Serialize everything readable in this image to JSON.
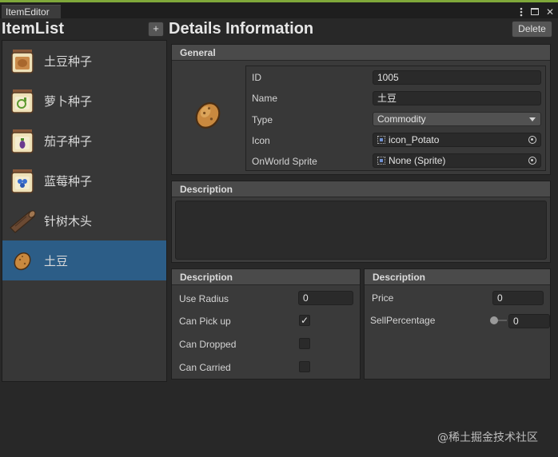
{
  "window": {
    "tab_title": "ItemEditor",
    "menu_icon": "kebab-menu-icon",
    "maximize_icon": "maximize-icon",
    "close_icon": "close-icon",
    "close_glyph": "✕",
    "accent_color": "#7fa83a"
  },
  "item_list": {
    "title": "ItemList",
    "add_label": "+",
    "items": [
      {
        "label": "土豆种子",
        "icon": "potato-seed-jar-icon",
        "selected": false
      },
      {
        "label": "萝卜种子",
        "icon": "radish-seed-jar-icon",
        "selected": false
      },
      {
        "label": "茄子种子",
        "icon": "eggplant-seed-jar-icon",
        "selected": false
      },
      {
        "label": "蓝莓种子",
        "icon": "blueberry-seed-jar-icon",
        "selected": false
      },
      {
        "label": "针树木头",
        "icon": "log-icon",
        "selected": false
      },
      {
        "label": "土豆",
        "icon": "potato-icon",
        "selected": true
      }
    ],
    "selected_color": "#2c5d87"
  },
  "details": {
    "title": "Details Information",
    "delete_label": "Delete",
    "general": {
      "header": "General",
      "preview_icon": "potato-icon",
      "fields": {
        "id_label": "ID",
        "id_value": "1005",
        "name_label": "Name",
        "name_value": "土豆",
        "type_label": "Type",
        "type_value": "Commodity",
        "icon_label": "Icon",
        "icon_value": "icon_Potato",
        "world_label": "OnWorld Sprite",
        "world_value": "None (Sprite)"
      }
    },
    "description": {
      "header": "Description",
      "value": ""
    },
    "left_panel": {
      "header": "Description",
      "use_radius_label": "Use Radius",
      "use_radius_value": "0",
      "can_pick_up_label": "Can Pick up",
      "can_pick_up": true,
      "can_dropped_label": "Can Dropped",
      "can_dropped": false,
      "can_carried_label": "Can Carried",
      "can_carried": false,
      "check_glyph": "✓"
    },
    "right_panel": {
      "header": "Description",
      "price_label": "Price",
      "price_value": "0",
      "sell_label": "SellPercentage",
      "sell_value": "0"
    }
  },
  "watermark": "@稀土掘金技术社区"
}
